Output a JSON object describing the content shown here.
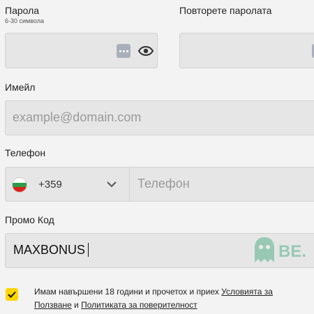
{
  "password": {
    "label": "Парола",
    "hint": "6-30 символа",
    "value": ""
  },
  "repeat_password": {
    "label": "Повторете паролата",
    "value": ""
  },
  "email": {
    "label": "Имейл",
    "placeholder": "example@domain.com",
    "value": ""
  },
  "phone": {
    "label": "Телефон",
    "country_code": "+359",
    "country": "Bulgaria",
    "placeholder": "Телефон",
    "value": ""
  },
  "promo": {
    "label": "Промо Код",
    "value": "MAXBONUS"
  },
  "consent": {
    "checked": true,
    "text_before": "Имам навършени 18 години и прочетох и приех ",
    "terms_link": "Условията за Ползване",
    "joiner": " и ",
    "privacy_link": "Политиката за поверителност"
  },
  "watermark": {
    "text": "BE."
  },
  "colors": {
    "background": "#f3f3f3",
    "field": "#e6e6e6",
    "checkbox": "#ffd600"
  }
}
